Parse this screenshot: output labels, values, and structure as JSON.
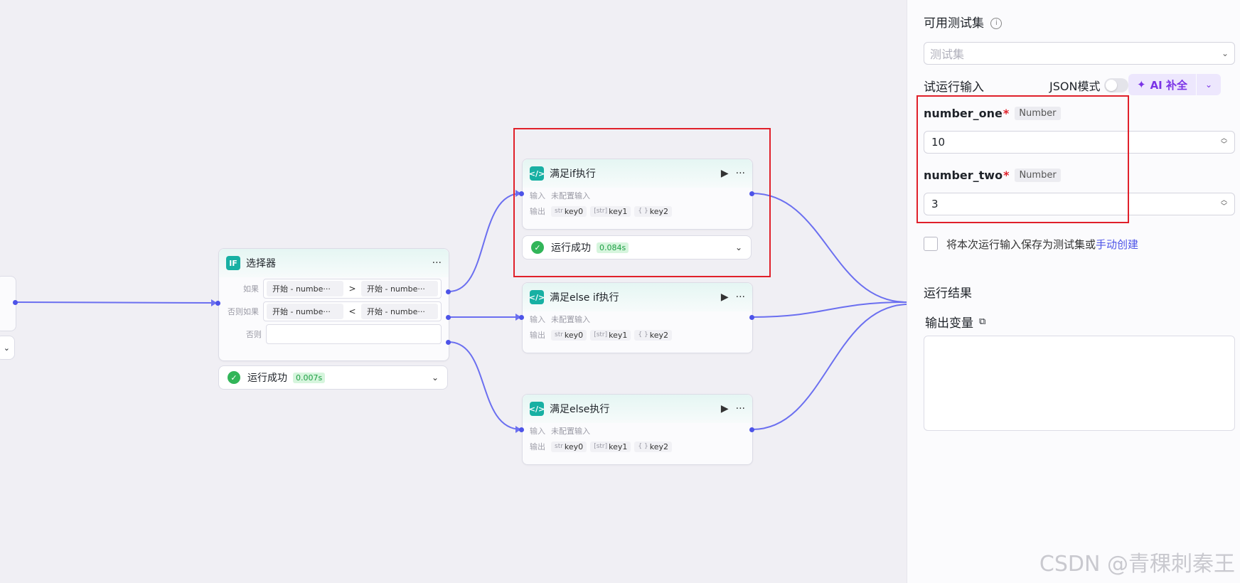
{
  "selector_node": {
    "icon_text": "IF",
    "title": "选择器",
    "more": "···",
    "conditions": [
      {
        "label": "如果",
        "left": "开始 - numbe···",
        "op": ">",
        "right": "开始 - numbe···"
      },
      {
        "label": "否则如果",
        "left": "开始 - numbe···",
        "op": "<",
        "right": "开始 - numbe···"
      },
      {
        "label": "否则",
        "left": "",
        "op": "",
        "right": ""
      }
    ],
    "status": {
      "text": "运行成功",
      "time": "0.007s"
    }
  },
  "code_nodes": [
    {
      "title": "满足if执行",
      "input_label": "输入",
      "input_value": "未配置输入",
      "output_label": "输出",
      "outputs": [
        {
          "type": "str",
          "name": "key0"
        },
        {
          "type": "[str]",
          "name": "key1"
        },
        {
          "type": "{ }",
          "name": "key2"
        }
      ],
      "status": {
        "text": "运行成功",
        "time": "0.084s"
      }
    },
    {
      "title": "满足else if执行",
      "input_label": "输入",
      "input_value": "未配置输入",
      "output_label": "输出",
      "outputs": [
        {
          "type": "str",
          "name": "key0"
        },
        {
          "type": "[str]",
          "name": "key1"
        },
        {
          "type": "{ }",
          "name": "key2"
        }
      ]
    },
    {
      "title": "满足else执行",
      "input_label": "输入",
      "input_value": "未配置输入",
      "output_label": "输出",
      "outputs": [
        {
          "type": "str",
          "name": "key0"
        },
        {
          "type": "[str]",
          "name": "key1"
        },
        {
          "type": "{ }",
          "name": "key2"
        }
      ]
    }
  ],
  "panel": {
    "testset_title": "可用测试集",
    "testset_placeholder": "测试集",
    "trial_input_title": "试运行输入",
    "json_mode_label": "JSON模式",
    "ai_fill_label": "AI 补全",
    "fields": [
      {
        "name": "number_one",
        "type": "Number",
        "value": "10"
      },
      {
        "name": "number_two",
        "type": "Number",
        "value": "3"
      }
    ],
    "save_text": "将本次运行输入保存为测试集或",
    "manual_create_link": "手动创建",
    "result_title": "运行结果",
    "output_var_title": "输出变量"
  },
  "watermark": "CSDN @青稞刺秦王",
  "colors": {
    "edge": "#6b6ff0",
    "port": "#4d53e8",
    "success": "#32b559",
    "highlight": "#e0202a",
    "ai": "#7a33e6",
    "link": "#4d53e8"
  }
}
